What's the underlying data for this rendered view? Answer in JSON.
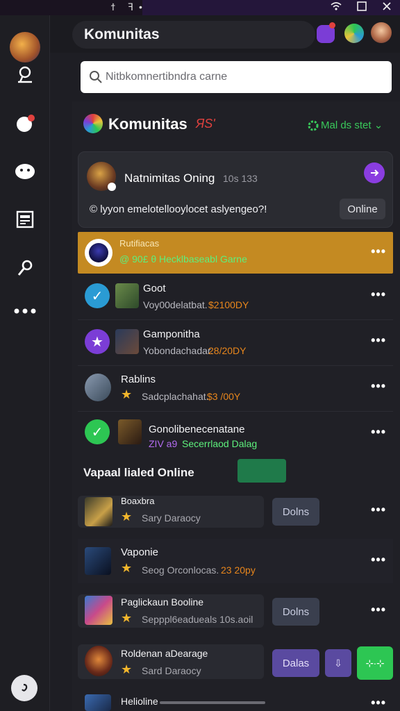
{
  "status_bar": {
    "left_glyphs": [
      "ϯ",
      "ꟻ",
      "•"
    ],
    "right_icons": [
      "wifi-icon",
      "square-icon",
      "close-icon"
    ]
  },
  "app_bar": {
    "title": "Komunitas"
  },
  "search": {
    "placeholder": "Nitbkomnertibndra carne"
  },
  "section": {
    "title": "Komunitas",
    "badge": "ЯS'",
    "link": "Mal ds stet ⌄"
  },
  "feature": {
    "title": "Natnimitas Oning",
    "meta": "10s 133",
    "message": "© lyyon emelotellooylocet aslyengeo?!",
    "button": "Online"
  },
  "highlight": {
    "title": "Rutifiacas",
    "subtitle": "@ 90£ θ Hecklbaseabl Garne"
  },
  "rows": [
    {
      "title": "Goot",
      "subtitle": "Voy00delatbat.",
      "price": "$2100DY"
    },
    {
      "title": "Gamponitha",
      "subtitle": "Yobondachadar.",
      "price": "28/20DY"
    },
    {
      "title": "Rablins",
      "subtitle": "Sadcplachahat.",
      "price": "$3 /00Y"
    },
    {
      "title": "Gonolibenecenatane",
      "subtitle": "ZIV a9",
      "price": "Secerrlaod Dalag"
    }
  ],
  "online_section": {
    "title": "Vapaal lialed Online"
  },
  "online_rows": [
    {
      "title": "Boaxbra",
      "subtitle": "Sary Daraocy",
      "button": "Dolns"
    },
    {
      "title": "Vaponie",
      "subtitle": "Seog Orconlocas.",
      "price": "23 20py"
    },
    {
      "title": "Paglickaun Booline",
      "subtitle": "Sepppl6eadueals 10s.aoil",
      "button": "Dolns"
    },
    {
      "title": "Roldenan aDearage",
      "subtitle": "Sard Daraocy",
      "button": "Dalas",
      "small_button": "⇩",
      "action": "⊹∙⊹"
    },
    {
      "title": "Helioline"
    }
  ],
  "colors": {
    "accent_orange": "#c48a22",
    "green": "#2dc653",
    "purple": "#6b4dc4",
    "blue": "#2a9bd4"
  }
}
